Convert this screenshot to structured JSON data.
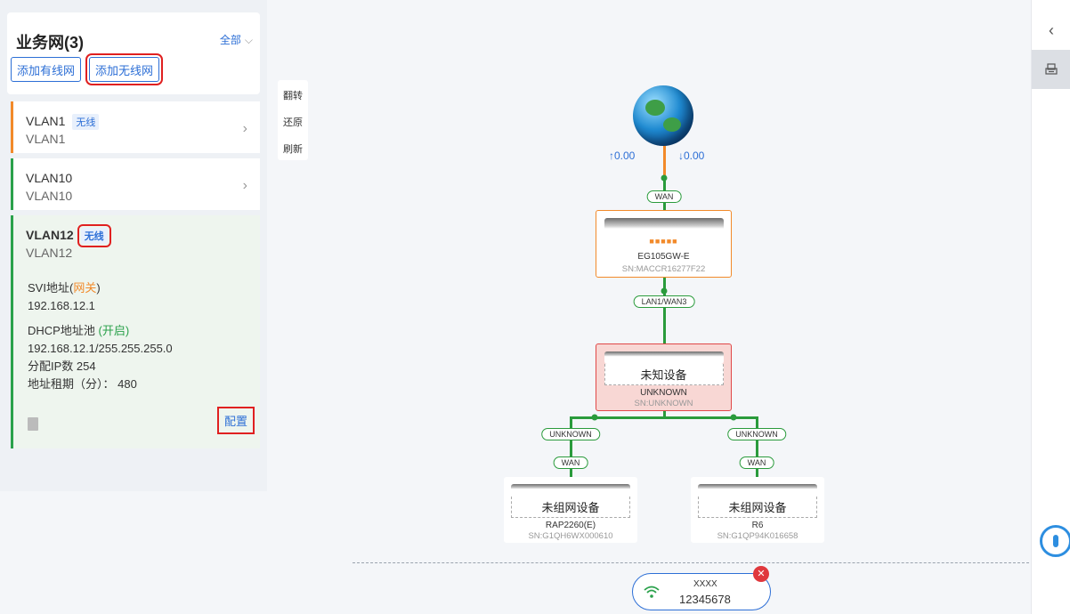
{
  "network_panel": {
    "title": "业务网(3)",
    "filter_label": "全部",
    "add_wired_label": "添加有线网",
    "add_wireless_label": "添加无线网"
  },
  "vlans": [
    {
      "name": "VLAN1",
      "tag": "无线",
      "sub": "VLAN1"
    },
    {
      "name": "VLAN10",
      "tag": "",
      "sub": "VLAN10"
    },
    {
      "name": "VLAN12",
      "tag": "无线",
      "sub": "VLAN12",
      "svi_label": "SVI地址",
      "svi_role": "网关",
      "svi_ip": "192.168.12.1",
      "dhcp_label": "DHCP地址池",
      "dhcp_status": "开启",
      "dhcp_range": "192.168.12.1/255.255.255.0",
      "ip_count": "分配IP数 254",
      "lease": "地址租期（分）： 480",
      "config_label": "配置"
    }
  ],
  "toolbar": {
    "flip": "翻转",
    "restore": "还原",
    "refresh": "刷新"
  },
  "topology": {
    "up_rate": "↑0.00",
    "down_rate": "↓0.00",
    "wan_port": "WAN",
    "gateway": {
      "model": "EG105GW-E",
      "sn": "SN:MACCR16277F22"
    },
    "gw_port": "LAN1/WAN3",
    "unknown_device": {
      "label": "未知设备",
      "model": "UNKNOWN",
      "sn": "SN:UNKNOWN"
    },
    "branch_port": "UNKNOWN",
    "ap_port": "WAN",
    "devices": [
      {
        "label": "未组网设备",
        "model": "RAP2260(E)",
        "sn": "SN:G1QH6WX000610"
      },
      {
        "label": "未组网设备",
        "model": "R6",
        "sn": "SN:G1QP94K016658"
      }
    ]
  },
  "wifi": {
    "ssid": "XXXX",
    "password": "12345678"
  },
  "icons": {
    "collapse": "chevron-left-icon",
    "device_list": "printer-icon",
    "wifi": "wifi-icon"
  },
  "colors": {
    "accent": "#2d6fd6",
    "link": "#2a9b3c",
    "gateway": "#f28a2a",
    "alert": "#e04848"
  }
}
